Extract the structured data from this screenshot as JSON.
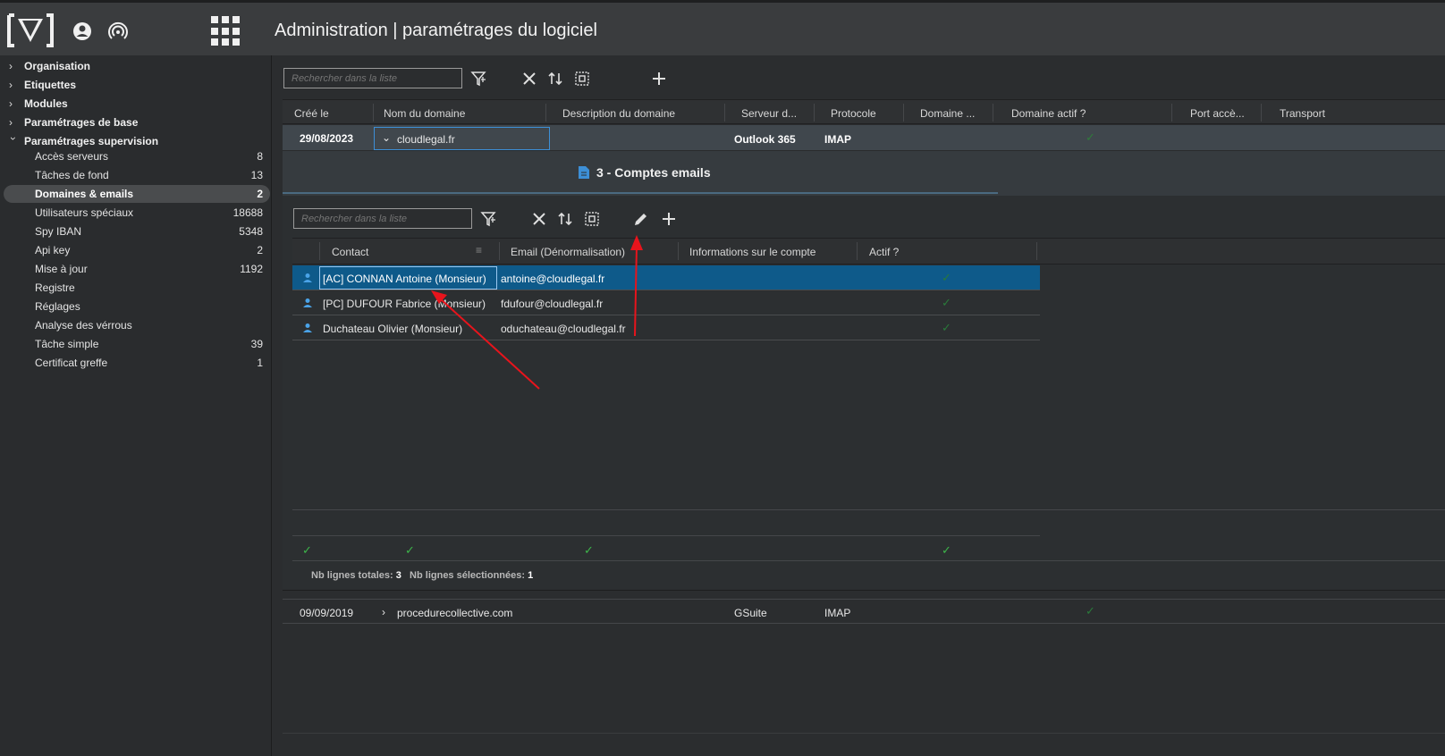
{
  "header": {
    "title": "Administration | paramétrages du logiciel"
  },
  "sidebar": {
    "groups": [
      {
        "label": "Organisation",
        "expanded": false
      },
      {
        "label": "Etiquettes",
        "expanded": false
      },
      {
        "label": "Modules",
        "expanded": false
      },
      {
        "label": "Paramétrages de base",
        "expanded": false
      },
      {
        "label": "Paramétrages supervision",
        "expanded": true
      }
    ],
    "items": [
      {
        "label": "Accès serveurs",
        "count": "8"
      },
      {
        "label": "Tâches de fond",
        "count": "13"
      },
      {
        "label": "Domaines & emails",
        "count": "2",
        "active": true
      },
      {
        "label": "Utilisateurs spéciaux",
        "count": "18688"
      },
      {
        "label": "Spy IBAN",
        "count": "5348"
      },
      {
        "label": "Api key",
        "count": "2"
      },
      {
        "label": "Mise à jour",
        "count": "1192"
      },
      {
        "label": "Registre",
        "count": ""
      },
      {
        "label": "Réglages",
        "count": ""
      },
      {
        "label": "Analyse des vérrous",
        "count": ""
      },
      {
        "label": "Tâche simple",
        "count": "39"
      },
      {
        "label": "Certificat greffe",
        "count": "1"
      }
    ]
  },
  "main": {
    "search_placeholder": "Rechercher dans la liste",
    "columns": [
      "Créé le",
      "Nom du domaine",
      "Description du domaine",
      "Serveur d...",
      "Protocole",
      "Domaine ...",
      "Domaine actif ?",
      "Port accè...",
      "Transport"
    ],
    "rows": [
      {
        "created": "29/08/2023",
        "domain": "cloudlegal.fr",
        "description": "",
        "server": "Outlook 365",
        "protocol": "IMAP",
        "active": true,
        "expanded": true
      },
      {
        "created": "09/09/2019",
        "domain": "procedurecollective.com",
        "description": "",
        "server": "GSuite",
        "protocol": "IMAP",
        "active": true,
        "expanded": false
      }
    ],
    "detail_title": "3 - Comptes emails"
  },
  "sub": {
    "search_placeholder": "Rechercher dans la liste",
    "columns": [
      "Contact",
      "Email (Dénormalisation)",
      "Informations sur le compte",
      "Actif ?"
    ],
    "rows": [
      {
        "contact": "[AC] CONNAN Antoine (Monsieur)",
        "email": "antoine@cloudlegal.fr",
        "info": "",
        "active": true
      },
      {
        "contact": "[PC] DUFOUR Fabrice (Monsieur)",
        "email": "fdufour@cloudlegal.fr",
        "info": "",
        "active": true
      },
      {
        "contact": "Duchateau Olivier (Monsieur)",
        "email": "oduchateau@cloudlegal.fr",
        "info": "",
        "active": true
      }
    ],
    "footer": {
      "total_label": "Nb lignes totales:",
      "total_value": "3",
      "selected_label": "Nb lignes sélectionnées:",
      "selected_value": "1"
    }
  },
  "colors": {
    "accent_blue": "#0e5a8a",
    "check_green": "#3db54a",
    "annotation_red": "#e8141c"
  }
}
